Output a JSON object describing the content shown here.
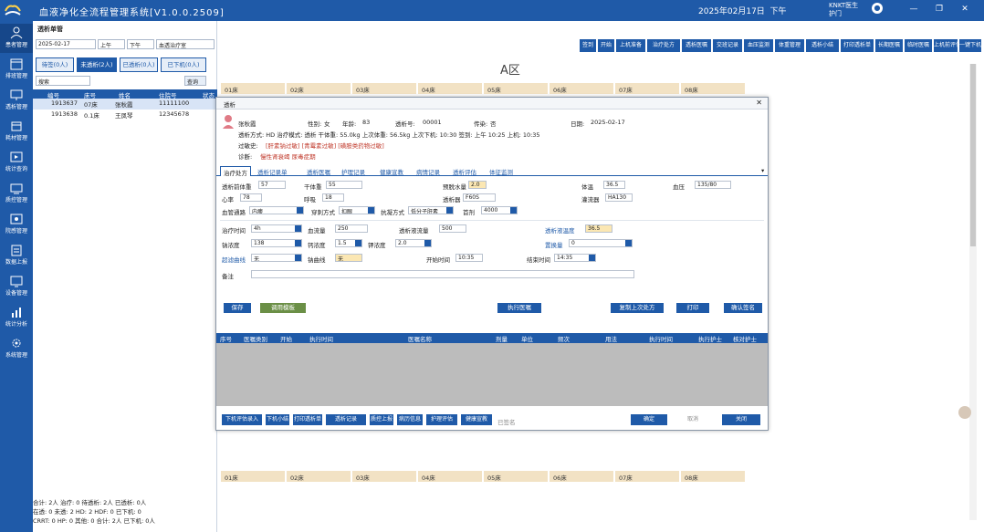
{
  "app": {
    "title": "血液净化全流程管理系统[V1.0.0.2509]",
    "datetime": "2025年02月17日",
    "ampm": "下午",
    "user_line1": "KNKT医生",
    "user_line2": "护门",
    "window_buttons": [
      "—",
      "❐",
      "✕"
    ]
  },
  "sidebar": {
    "items": [
      {
        "label": "患者管理",
        "icon": "users-icon"
      },
      {
        "label": "排班管理",
        "icon": "calendar-icon"
      },
      {
        "label": "透析管理",
        "icon": "monitor-icon"
      },
      {
        "label": "耗材管理",
        "icon": "box-icon"
      },
      {
        "label": "统计查询",
        "icon": "chart-icon"
      },
      {
        "label": "质控管理",
        "icon": "shield-icon"
      },
      {
        "label": "院感管理",
        "icon": "virus-icon"
      },
      {
        "label": "数据上报",
        "icon": "upload-icon"
      },
      {
        "label": "设备管理",
        "icon": "device-icon"
      },
      {
        "label": "统计分析",
        "icon": "bar-icon"
      },
      {
        "label": "系统管理",
        "icon": "gear-icon"
      }
    ]
  },
  "left": {
    "title": "透析单管",
    "date": "2025-02-17",
    "shift": "上午",
    "period_label": "下午",
    "ward": "血透治疗室",
    "all": "全部",
    "region": "全部",
    "tabs": [
      "待签(0人)",
      "未透析(2人)",
      "已透析(0人)",
      "已下机(0人)"
    ],
    "search_placeholder": "搜索",
    "search_btn": "查询",
    "columns": [
      "编号",
      "床号",
      "姓名",
      "住院号",
      "状态"
    ],
    "rows": [
      [
        "1913637",
        "07床",
        "张秋霞",
        "11111100",
        "0"
      ],
      [
        "1913638",
        "0.1床",
        "王凤琴",
        "12345678",
        "0"
      ]
    ],
    "stats": [
      "合计: 2人  治疗: 0  待透析: 2人  已透析: 0人",
      "在透: 0  未透: 2  HD: 2  HDF: 0  已下机: 0",
      "CRRT: 0  HP: 0  其他: 0  合计: 2人  已下机: 0人"
    ]
  },
  "toolbar": {
    "buttons": [
      "签到",
      "开始",
      "上机准备",
      "治疗处方",
      "透析医嘱",
      "交班记录",
      "血压监测",
      "体重管理",
      "透析小结",
      "打印透析单",
      "长期医嘱",
      "临时医嘱",
      "上机前评估",
      "一键下机",
      "护理记录"
    ]
  },
  "area": {
    "title": "A区",
    "beds_top": [
      "01床",
      "02床",
      "03床",
      "04床",
      "05床",
      "06床",
      "07床",
      "08床"
    ],
    "beds_bottom": [
      "01床",
      "02床",
      "03床",
      "04床",
      "05床",
      "06床",
      "07床",
      "08床"
    ]
  },
  "dialog": {
    "title": "透析",
    "close": "✕",
    "patient": {
      "name": "张秋霞",
      "gender_label": "性别:",
      "gender": "女",
      "age_label": "年龄:",
      "age": "83",
      "dialysis_no_label": "透析号:",
      "dialysis_no": "00001",
      "infection_label": "传染:",
      "infection": "否",
      "date_label": "日期:",
      "date": "2025-02-17",
      "line2": "透析方式: HD  治疗模式: 透析  干体重: 55.0kg  上次体重: 56.5kg  上次下机: 10:30  签到: 上午 10:25  上机: 10:35",
      "allergy_label": "过敏史:",
      "allergy": "[肝素钠过敏] [青霉素过敏] [磺胺类药物过敏]",
      "diag_label": "诊断:",
      "diag": "慢性肾衰竭 尿毒症期"
    },
    "tabs": [
      "治疗处方",
      "透析记录单",
      "透析医嘱",
      "护理记录",
      "健康宣教",
      "病情记录",
      "透析评估",
      "体征监测"
    ],
    "form": {
      "r1_l1": "透析前体重",
      "r1_v1": "57",
      "r1_l2": "干体重",
      "r1_v2": "55",
      "r1_l3": "预脱水量",
      "r1_v3": "2.0",
      "r1_l4": "体温",
      "r1_v4": "36.5",
      "r1_l5": "血压",
      "r1_v5": "135/80",
      "r2_l1": "心率",
      "r2_v1": "78",
      "r2_l2": "呼吸",
      "r2_v2": "18",
      "r2_l3": "透析器",
      "r2_v3": "F60S",
      "r2_l4": "灌流器",
      "r2_v4": "HA130",
      "r3_l1": "血管通路",
      "r3_v1": "内瘘",
      "r3_l2": "穿刺方式",
      "r3_v2": "扣眼",
      "r3_l3": "抗凝方式",
      "r3_v3": "低分子肝素",
      "r3_l4": "首剂",
      "r3_v4": "4000",
      "r4_l1": "治疗时间",
      "r4_v1": "4h",
      "r4_l2": "血流量",
      "r4_v2": "250",
      "r4_l3": "透析液流量",
      "r4_v3": "500",
      "r4_l4": "透析液温度",
      "r4_v4": "36.5",
      "r5_l1": "钠浓度",
      "r5_v1": "138",
      "r5_l2": "钙浓度",
      "r5_v2": "1.5",
      "r5_l3": "钾浓度",
      "r5_v3": "2.0",
      "r5_l4": "置换量",
      "r5_v4": "0",
      "r6_l1": "超滤曲线",
      "r6_v1": "无",
      "r6_l2": "钠曲线",
      "r6_v2": "无",
      "r6_l3": "开始时间",
      "r6_v3": "10:35",
      "r6_l4": "结束时间",
      "r6_v4": "14:35",
      "r7_l1": "备注",
      "r7_v1": ""
    },
    "buttons": {
      "save": "保存",
      "template": "调用模板",
      "exec": "执行医嘱",
      "copy": "复制上次处方",
      "print": "打印",
      "sign": "确认签名"
    },
    "order_columns": [
      "序号",
      "医嘱类别",
      "开始",
      "执行时间",
      "医嘱名称",
      "剂量",
      "单位",
      "频次",
      "用法",
      "执行时间",
      "执行护士",
      "核对护士"
    ],
    "footer_buttons": [
      "下机评估录入",
      "下机小结",
      "打印透析单",
      "透析记录",
      "质控上报",
      "病历信息",
      "护理评估",
      "健康宣教"
    ],
    "footer_note": "已签名",
    "footer_right": [
      "确定",
      "取消",
      "关闭"
    ]
  }
}
